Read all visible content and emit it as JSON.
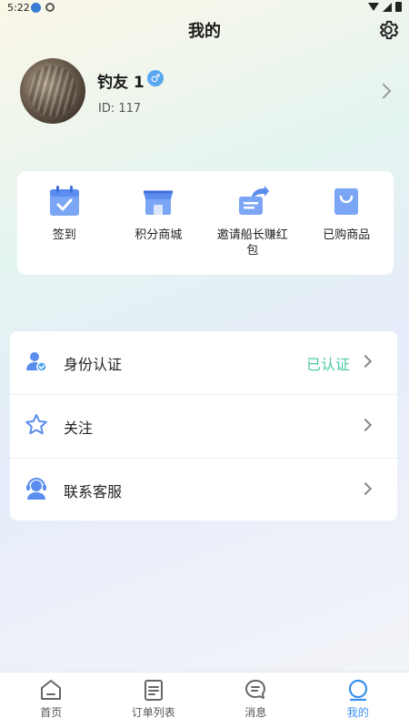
{
  "status_bar": {
    "time": "5:22"
  },
  "header": {
    "title": "我的"
  },
  "profile": {
    "name": "钓友 1",
    "gender_symbol": "♂",
    "id_text": "ID: 117"
  },
  "quick_actions": [
    {
      "label": "签到",
      "icon": "calendar-check-icon"
    },
    {
      "label": "积分商城",
      "icon": "shop-icon"
    },
    {
      "label": "邀请船长赚红包",
      "icon": "invite-share-icon"
    },
    {
      "label": "已购商品",
      "icon": "shopping-bag-icon"
    }
  ],
  "menu": [
    {
      "label": "身份认证",
      "status": "已认证",
      "icon": "user-verified-icon"
    },
    {
      "label": "关注",
      "status": "",
      "icon": "star-icon"
    },
    {
      "label": "联系客服",
      "status": "",
      "icon": "customer-service-icon"
    }
  ],
  "tabs": [
    {
      "label": "首页",
      "icon": "home-icon",
      "active": false
    },
    {
      "label": "订单列表",
      "icon": "order-list-icon",
      "active": false
    },
    {
      "label": "消息",
      "icon": "message-icon",
      "active": false
    },
    {
      "label": "我的",
      "icon": "profile-icon",
      "active": true
    }
  ],
  "colors": {
    "accent": "#3b8ff0",
    "verified": "#4cc8a8",
    "icon_blue": "#5b8def"
  }
}
